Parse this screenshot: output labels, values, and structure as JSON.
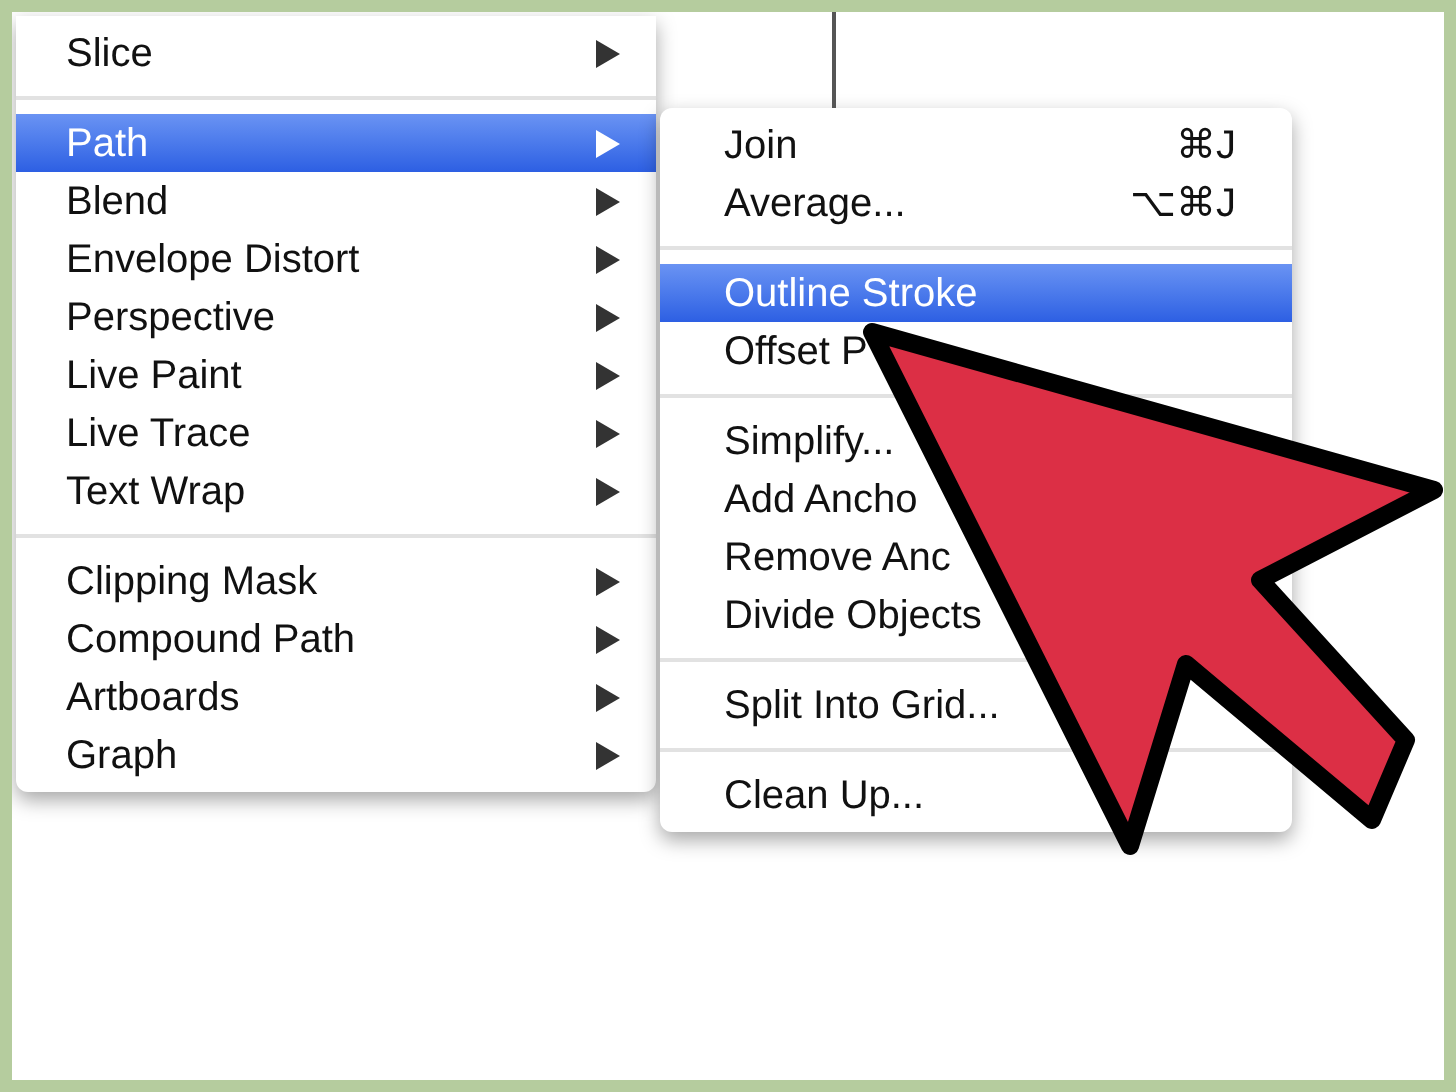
{
  "main_menu": {
    "sections": [
      [
        {
          "label": "Slice",
          "has_submenu": true,
          "selected": false
        }
      ],
      [
        {
          "label": "Path",
          "has_submenu": true,
          "selected": true
        },
        {
          "label": "Blend",
          "has_submenu": true,
          "selected": false
        },
        {
          "label": "Envelope Distort",
          "has_submenu": true,
          "selected": false
        },
        {
          "label": "Perspective",
          "has_submenu": true,
          "selected": false
        },
        {
          "label": "Live Paint",
          "has_submenu": true,
          "selected": false
        },
        {
          "label": "Live Trace",
          "has_submenu": true,
          "selected": false
        },
        {
          "label": "Text Wrap",
          "has_submenu": true,
          "selected": false
        }
      ],
      [
        {
          "label": "Clipping Mask",
          "has_submenu": true,
          "selected": false
        },
        {
          "label": "Compound Path",
          "has_submenu": true,
          "selected": false
        },
        {
          "label": "Artboards",
          "has_submenu": true,
          "selected": false
        },
        {
          "label": "Graph",
          "has_submenu": true,
          "selected": false
        }
      ]
    ]
  },
  "submenu": {
    "sections": [
      [
        {
          "label": "Join",
          "shortcut": "⌘J",
          "selected": false
        },
        {
          "label": "Average...",
          "shortcut": "⌥⌘J",
          "selected": false
        }
      ],
      [
        {
          "label": "Outline Stroke",
          "selected": true
        },
        {
          "label": "Offset P",
          "selected": false
        }
      ],
      [
        {
          "label": "Simplify...",
          "selected": false
        },
        {
          "label": "Add Ancho",
          "selected": false
        },
        {
          "label": "Remove Anc",
          "selected": false
        },
        {
          "label": "Divide Objects",
          "selected": false
        }
      ],
      [
        {
          "label": "Split Into Grid...",
          "selected": false
        }
      ],
      [
        {
          "label": "Clean Up...",
          "selected": false
        }
      ]
    ]
  }
}
